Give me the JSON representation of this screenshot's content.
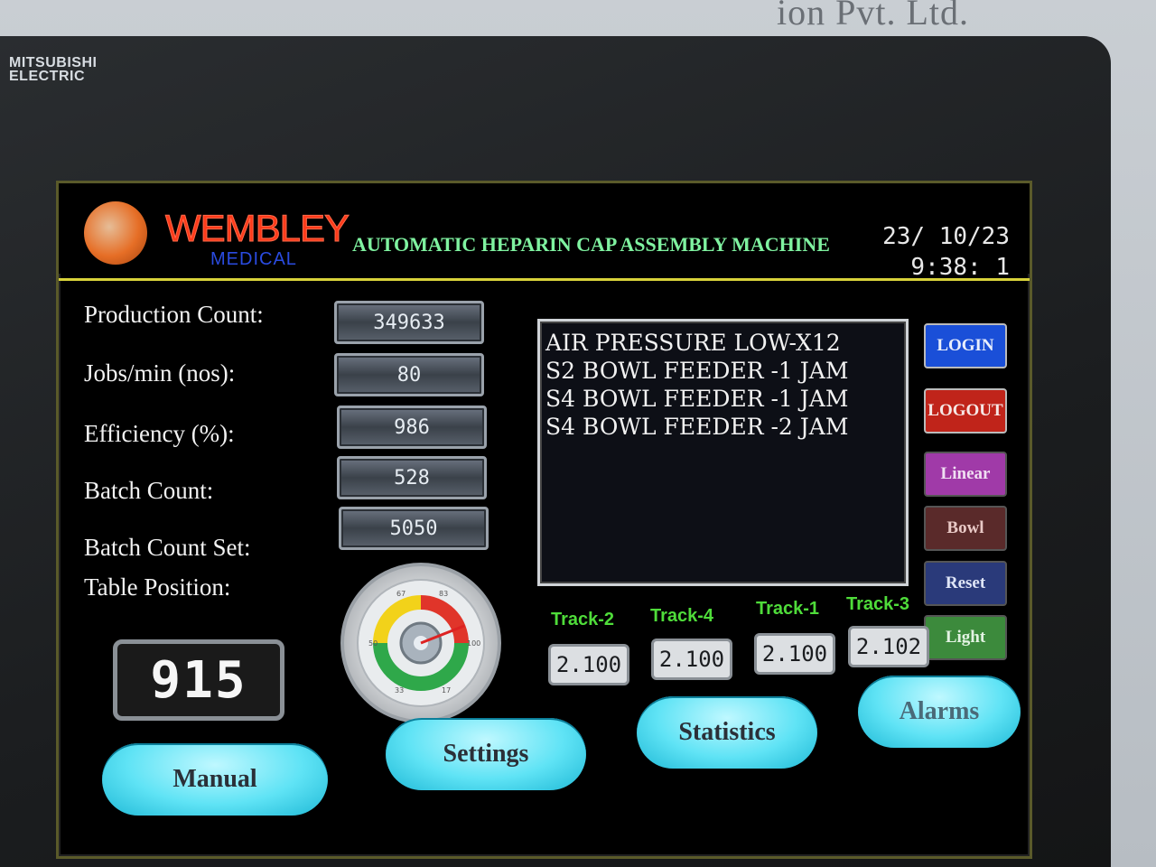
{
  "device": {
    "brand_line1": "MITSUBISHI",
    "brand_line2": "ELECTRIC",
    "company_partial": "ion Pvt. Ltd."
  },
  "header": {
    "logo_word": "WEMBLEY",
    "logo_sub": "MEDICAL",
    "title": "AUTOMATIC HEPARIN CAP ASSEMBLY MACHINE",
    "date": "23/ 10/23",
    "time": "9:38:  1"
  },
  "stats": {
    "production_count_label": "Production Count:",
    "production_count": "349633",
    "jobs_label": "Jobs/min (nos):",
    "jobs": "80",
    "efficiency_label": "Efficiency (%):",
    "efficiency": "986",
    "batch_count_label": "Batch Count:",
    "batch_count": "528",
    "batch_set_label": "Batch Count Set:",
    "batch_set": "5050",
    "table_position_label": "Table Position:",
    "table_position": "915"
  },
  "alarms": [
    "AIR PRESSURE LOW-X12",
    "S2 BOWL FEEDER -1 JAM",
    "S4 BOWL FEEDER -1 JAM",
    "S4 BOWL FEEDER -2 JAM"
  ],
  "side_buttons": {
    "login": "LOGIN",
    "logout": "LOGOUT",
    "linear": "Linear",
    "bowl": "Bowl",
    "reset": "Reset",
    "light": "Light"
  },
  "tracks": [
    {
      "label": "Track-2",
      "value": "2.100"
    },
    {
      "label": "Track-4",
      "value": "2.100"
    },
    {
      "label": "Track-1",
      "value": "2.100"
    },
    {
      "label": "Track-3",
      "value": "2.102"
    }
  ],
  "gauge": {
    "ticks": [
      "67",
      "83",
      "100",
      "50",
      "33",
      "17"
    ],
    "value": 88
  },
  "nav": {
    "manual": "Manual",
    "settings": "Settings",
    "statistics": "Statistics",
    "alarms": "Alarms"
  },
  "colors": {
    "title": "#7ff2a0",
    "logo": "#ff3a1a",
    "track_label": "#4fdc3a",
    "nav_button": "#5fe3f5"
  }
}
